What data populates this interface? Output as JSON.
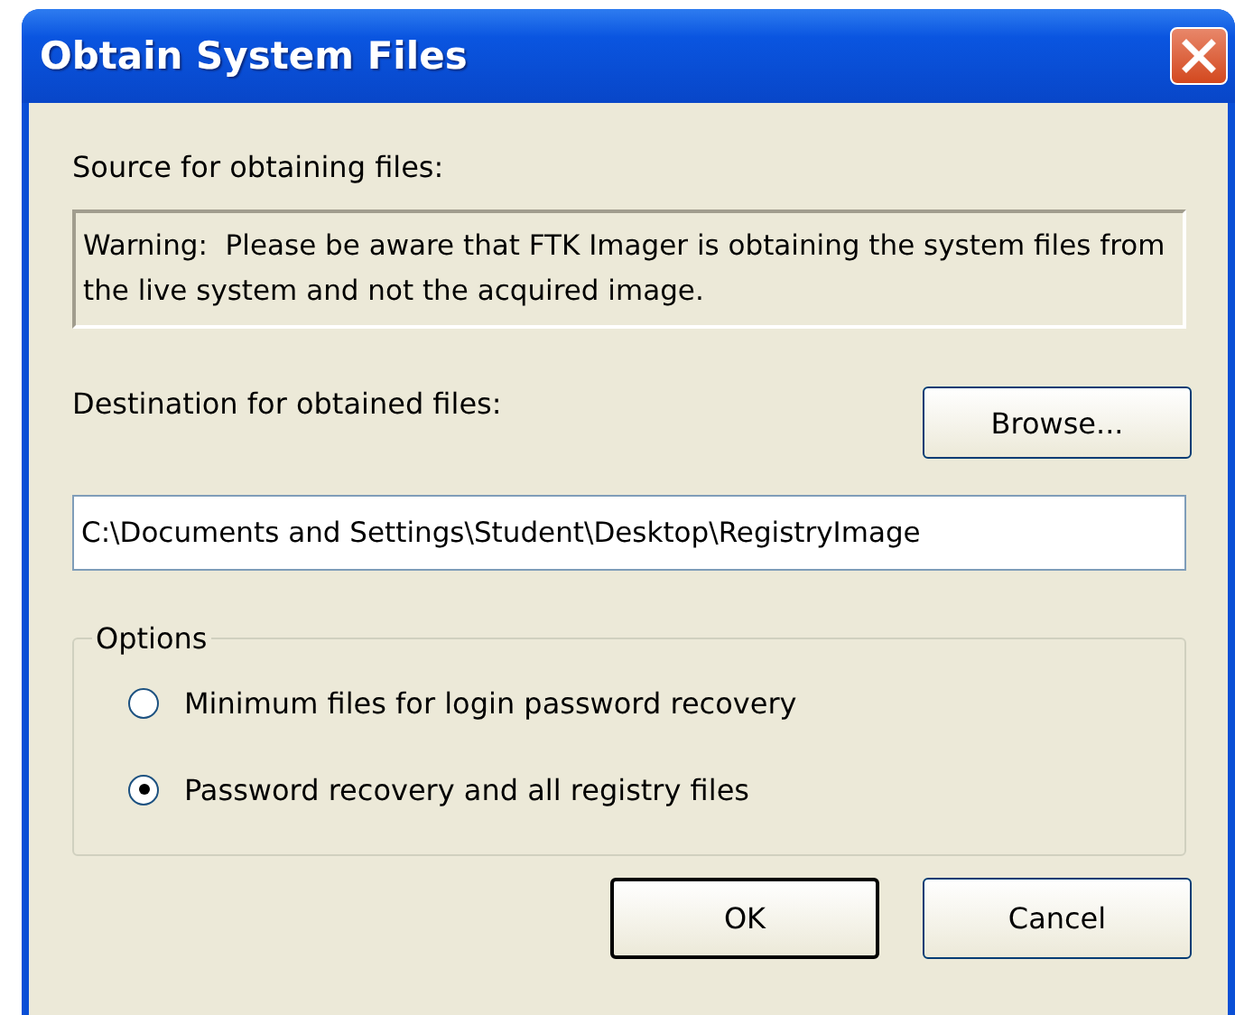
{
  "window": {
    "title": "Obtain System Files"
  },
  "source": {
    "label": "Source for obtaining files:",
    "warning": "Warning:  Please be aware that FTK Imager is obtaining the system files from the live system and not the acquired image."
  },
  "destination": {
    "label": "Destination for obtained files:",
    "browse_button": "Browse...",
    "value": "C:\\Documents and Settings\\Student\\Desktop\\RegistryImage"
  },
  "options": {
    "legend": "Options",
    "choices": [
      {
        "label": "Minimum files for login password recovery",
        "selected": false
      },
      {
        "label": "Password recovery and all registry files",
        "selected": true
      }
    ]
  },
  "buttons": [
    {
      "label": "OK",
      "kind": "default"
    },
    {
      "label": "Cancel",
      "kind": "normal"
    }
  ]
}
